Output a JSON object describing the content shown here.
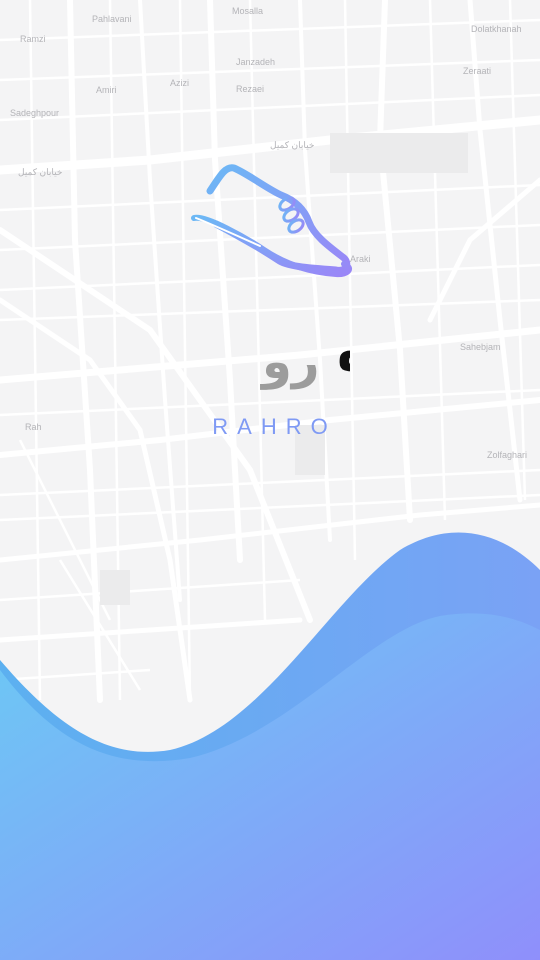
{
  "app": {
    "name_latin": "RAHRO",
    "name_persian_part1": "راه",
    "name_persian_part2": "رو"
  },
  "map": {
    "street_labels": [
      "Pahlavani",
      "Mosalla",
      "Ramzi",
      "Amiri",
      "Janzadeh",
      "Dolatkhanah",
      "Sadeghpour",
      "Azizi",
      "Rezaei",
      "Zeraati",
      "خیابان کمیل",
      "Araki",
      "Rah",
      "Zolfaghari",
      "Sahebjam",
      "خیابان کمیل"
    ]
  },
  "colors": {
    "background": "#f4f4f5",
    "map_streets": "#ffffff",
    "wave_start": "#6bcaf4",
    "wave_end": "#8f8ffb",
    "brand_dark": "#111111",
    "brand_grey": "#9c9c9c",
    "brand_accent": "#7f9af4"
  },
  "icons": {
    "logo": "running-shoe-icon"
  }
}
